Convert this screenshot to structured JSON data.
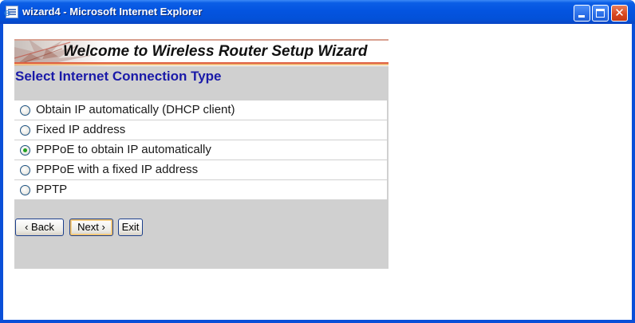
{
  "window": {
    "title": "wizard4 - Microsoft Internet Explorer",
    "controls": {
      "minimize": "minimize",
      "maximize": "maximize",
      "close": "✕"
    }
  },
  "wizard": {
    "banner_text": "Welcome to Wireless Router Setup Wizard",
    "section_title": "Select Internet Connection Type",
    "options": [
      {
        "label": "Obtain IP automatically (DHCP client)",
        "checked": false
      },
      {
        "label": "Fixed IP address",
        "checked": false
      },
      {
        "label": "PPPoE to obtain IP automatically",
        "checked": true
      },
      {
        "label": "PPPoE with a fixed IP address",
        "checked": false
      },
      {
        "label": "PPTP",
        "checked": false
      }
    ],
    "buttons": {
      "back": "‹ Back",
      "next": "Next ›",
      "exit": "Exit"
    }
  },
  "colors": {
    "title_bar": "#0454e0",
    "section_title": "#1a1aa8",
    "panel_bg": "#d0d0d0",
    "radio_selected": "#21a121",
    "banner_accent": "#e06040"
  }
}
